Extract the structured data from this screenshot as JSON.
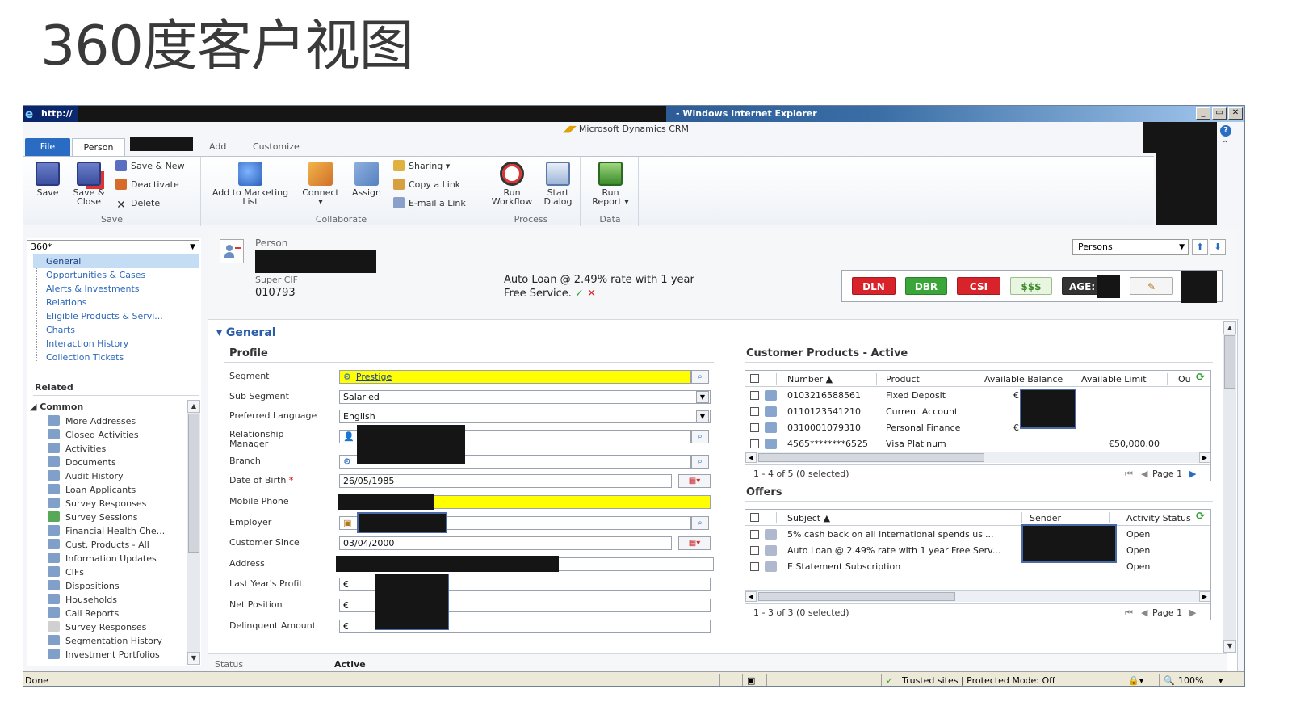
{
  "slide_title": "360度客户视图",
  "browser": {
    "url_prefix": "http://",
    "window_title": "- Windows Internet Explorer",
    "controls": [
      "_",
      "▭",
      "✕"
    ],
    "brand": "Microsoft Dynamics CRM"
  },
  "ribbon": {
    "tabs": {
      "file": "File",
      "person": "Person",
      "add": "Add",
      "customize": "Customize"
    },
    "save_group": {
      "label": "Save",
      "save": "Save",
      "save_close_1": "Save &",
      "save_close_2": "Close",
      "save_new": "Save & New",
      "deactivate": "Deactivate",
      "delete": "Delete"
    },
    "collaborate_group": {
      "label": "Collaborate",
      "add_marketing_1": "Add to Marketing",
      "add_marketing_2": "List",
      "connect": "Connect",
      "connect_arrow": "▾",
      "assign": "Assign",
      "sharing": "Sharing ▾",
      "copy_link": "Copy a Link",
      "email_link": "E-mail a Link"
    },
    "process_group": {
      "label": "Process",
      "run_workflow_1": "Run",
      "run_workflow_2": "Workflow",
      "start_dialog_1": "Start",
      "start_dialog_2": "Dialog"
    },
    "data_group": {
      "label": "Data",
      "run_report_1": "Run",
      "run_report_2": "Report ▾"
    }
  },
  "left_nav": {
    "form_selector": "360*",
    "form_links": [
      "General",
      "Opportunities & Cases",
      "Alerts & Investments",
      "Relations",
      "Eligible Products & Servi...",
      "Charts",
      "Interaction History",
      "Collection Tickets"
    ],
    "related_heading": "Related",
    "common_heading": "◢ Common",
    "common_items": [
      "More Addresses",
      "Closed Activities",
      "Activities",
      "Documents",
      "Audit History",
      "Loan Applicants",
      "Survey Responses",
      "Survey Sessions",
      "Financial Health Che...",
      "Cust. Products - All",
      "Information Updates",
      "CIFs",
      "Dispositions",
      "Households",
      "Call Reports",
      "Survey Responses",
      "Segmentation History",
      "Investment Portfolios"
    ]
  },
  "header": {
    "entity_label": "Person",
    "super_cif_label": "Super CIF",
    "super_cif_value": "010793",
    "promo_line1": "Auto Loan @ 2.49% rate with 1 year",
    "promo_line2": "Free Service.",
    "promo_ok": "✓",
    "promo_no": "✕",
    "record_selector": "Persons",
    "badges": {
      "dln": "DLN",
      "dbr": "DBR",
      "csi": "CSI",
      "money": "$$$",
      "age": "AGE:",
      "edit": "✎"
    },
    "colors": {
      "dln": "#d9232a",
      "dbr": "#3aa63a",
      "csi": "#d9232a",
      "money": "#e8f5e0",
      "age": "#333333"
    }
  },
  "general": {
    "section_title": "▾ General",
    "profile_title": "Profile",
    "fields": {
      "segment_label": "Segment",
      "segment_value": "Prestige",
      "sub_segment_label": "Sub Segment",
      "sub_segment_value": "Salaried",
      "language_label": "Preferred Language",
      "language_value": "English",
      "rm_label_1": "Relationship",
      "rm_label_2": "Manager",
      "branch_label": "Branch",
      "dob_label": "Date of Birth",
      "dob_required": "*",
      "dob_value": "26/05/1985",
      "mobile_label": "Mobile Phone",
      "employer_label": "Employer",
      "customer_since_label": "Customer Since",
      "customer_since_value": "03/04/2000",
      "address_label": "Address",
      "last_year_profit_label": "Last Year's Profit",
      "net_position_label": "Net Position",
      "delinquent_label": "Delinquent Amount",
      "currency": "€"
    }
  },
  "customer_products": {
    "title": "Customer Products - Active",
    "columns": [
      "Number ▲",
      "Product",
      "Available Balance",
      "Available Limit",
      "Ou"
    ],
    "rows": [
      {
        "number": "0103216588561",
        "product": "Fixed Deposit",
        "balance": "€",
        "limit": ""
      },
      {
        "number": "0110123541210",
        "product": "Current Account",
        "balance": "",
        "limit": ""
      },
      {
        "number": "0310001079310",
        "product": "Personal Finance",
        "balance": "€",
        "limit": ""
      },
      {
        "number": "4565********6525",
        "product": "Visa Platinum",
        "balance": "",
        "limit": "€50,000.00"
      }
    ],
    "footer": "1 - 4 of 5 (0 selected)",
    "pager": "Page 1"
  },
  "offers": {
    "title": "Offers",
    "columns": [
      "Subject ▲",
      "Sender",
      "Activity Status"
    ],
    "rows": [
      {
        "subject": "5% cash back on all international spends usi...",
        "status": "Open"
      },
      {
        "subject": "Auto Loan @ 2.49% rate with 1 year Free Serv...",
        "status": "Open"
      },
      {
        "subject": "E Statement Subscription",
        "status": "Open"
      }
    ],
    "footer": "1 - 3 of 3 (0 selected)",
    "pager": "Page 1"
  },
  "form_status": {
    "label": "Status",
    "value": "Active"
  },
  "ie_status": {
    "done": "Done",
    "zone": "Trusted sites | Protected Mode: Off",
    "zoom": "100%"
  }
}
